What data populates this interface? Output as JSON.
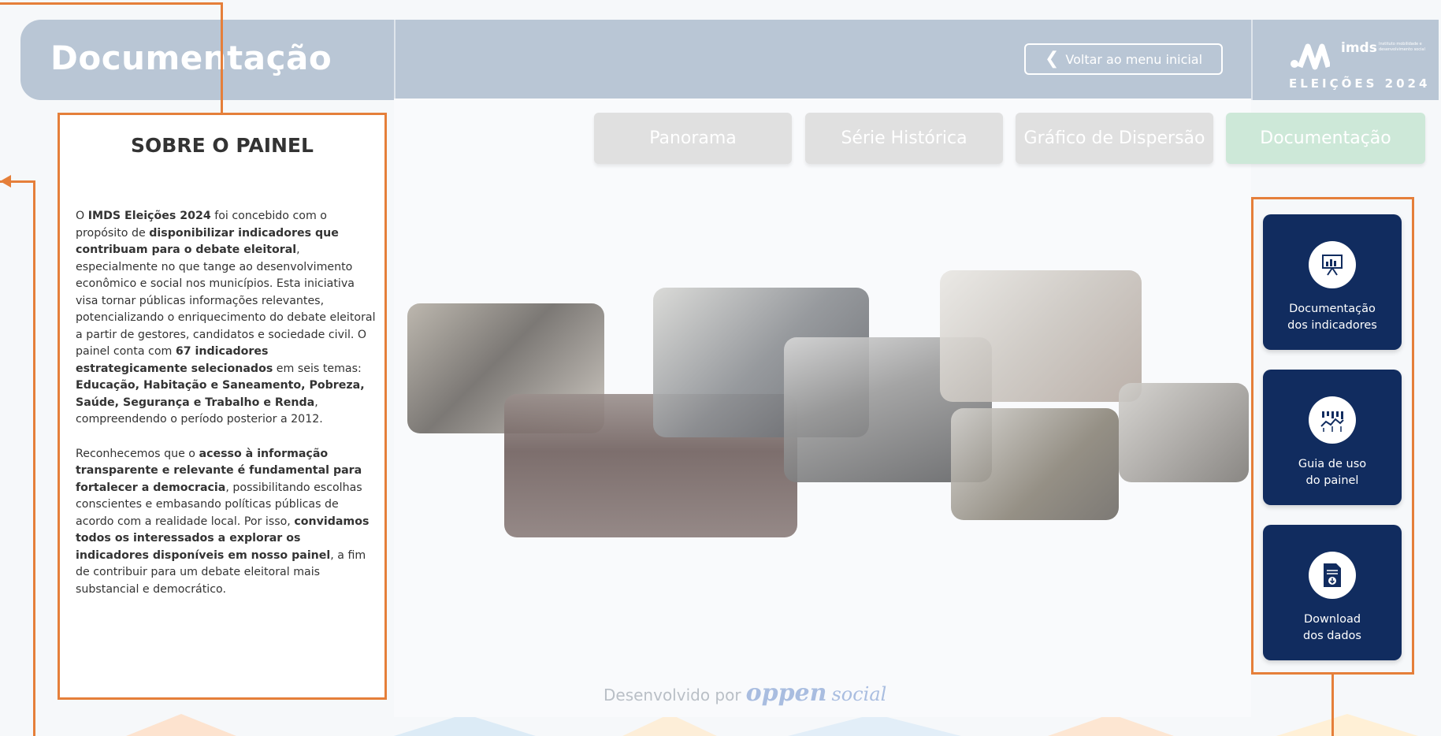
{
  "header": {
    "title": "Documentação",
    "back_button": "Voltar ao menu inicial",
    "logo": {
      "name": "imds",
      "tagline": "Instituto mobilidade e desenvolvimento social",
      "subtitle": "ELEIÇÕES 2024"
    }
  },
  "tabs": [
    {
      "label": "Panorama",
      "active": false
    },
    {
      "label": "Série Histórica",
      "active": false
    },
    {
      "label": "Gráfico de Dispersão",
      "active": false
    },
    {
      "label": "Documentação",
      "active": true
    }
  ],
  "about": {
    "title": "SOBRE O PAINEL",
    "p1": [
      {
        "t": "O ",
        "b": false
      },
      {
        "t": "IMDS Eleições 2024",
        "b": true
      },
      {
        "t": " foi concebido com o propósito de ",
        "b": false
      },
      {
        "t": "disponibilizar indicadores que contribuam para o debate eleitoral",
        "b": true
      },
      {
        "t": ", especialmente no que tange ao desenvolvimento econômico e social nos municípios. Esta iniciativa visa tornar públicas informações relevantes, potencializando o enriquecimento do debate eleitoral a partir de gestores, candidatos e sociedade civil. O painel conta com ",
        "b": false
      },
      {
        "t": "67 indicadores estrategicamente selecionados",
        "b": true
      },
      {
        "t": " em seis temas: ",
        "b": false
      },
      {
        "t": "Educação, Habitação e Saneamento, Pobreza, Saúde, Segurança e Trabalho e Renda",
        "b": true
      },
      {
        "t": ", compreendendo o período posterior a 2012.",
        "b": false
      }
    ],
    "p2": [
      {
        "t": "Reconhecemos que o ",
        "b": false
      },
      {
        "t": "acesso à informação transparente e relevante é fundamental para fortalecer a democracia",
        "b": true
      },
      {
        "t": ", possibilitando escolhas conscientes e embasando políticas públicas de acordo com a realidade local. Por isso, ",
        "b": false
      },
      {
        "t": "convidamos todos os interessados a explorar os indicadores disponíveis em nosso painel",
        "b": true
      },
      {
        "t": ", a fim de contribuir para um debate eleitoral mais substancial e democrático.",
        "b": false
      }
    ]
  },
  "side_buttons": [
    {
      "label_line1": "Documentação",
      "label_line2": "dos indicadores",
      "icon": "presentation-chart-icon"
    },
    {
      "label_line1": "Guia de uso",
      "label_line2": "do painel",
      "icon": "guide-chart-icon"
    },
    {
      "label_line1": "Download",
      "label_line2": "dos dados",
      "icon": "download-document-icon"
    }
  ],
  "footer": {
    "developed_by": "Desenvolvido por",
    "brand_bold": "oppen",
    "brand_light": "social"
  },
  "colors": {
    "header": "#b9c6d5",
    "annotation": "#e57f3a",
    "card": "#112c5f",
    "active_tab": "#cde8d8"
  }
}
